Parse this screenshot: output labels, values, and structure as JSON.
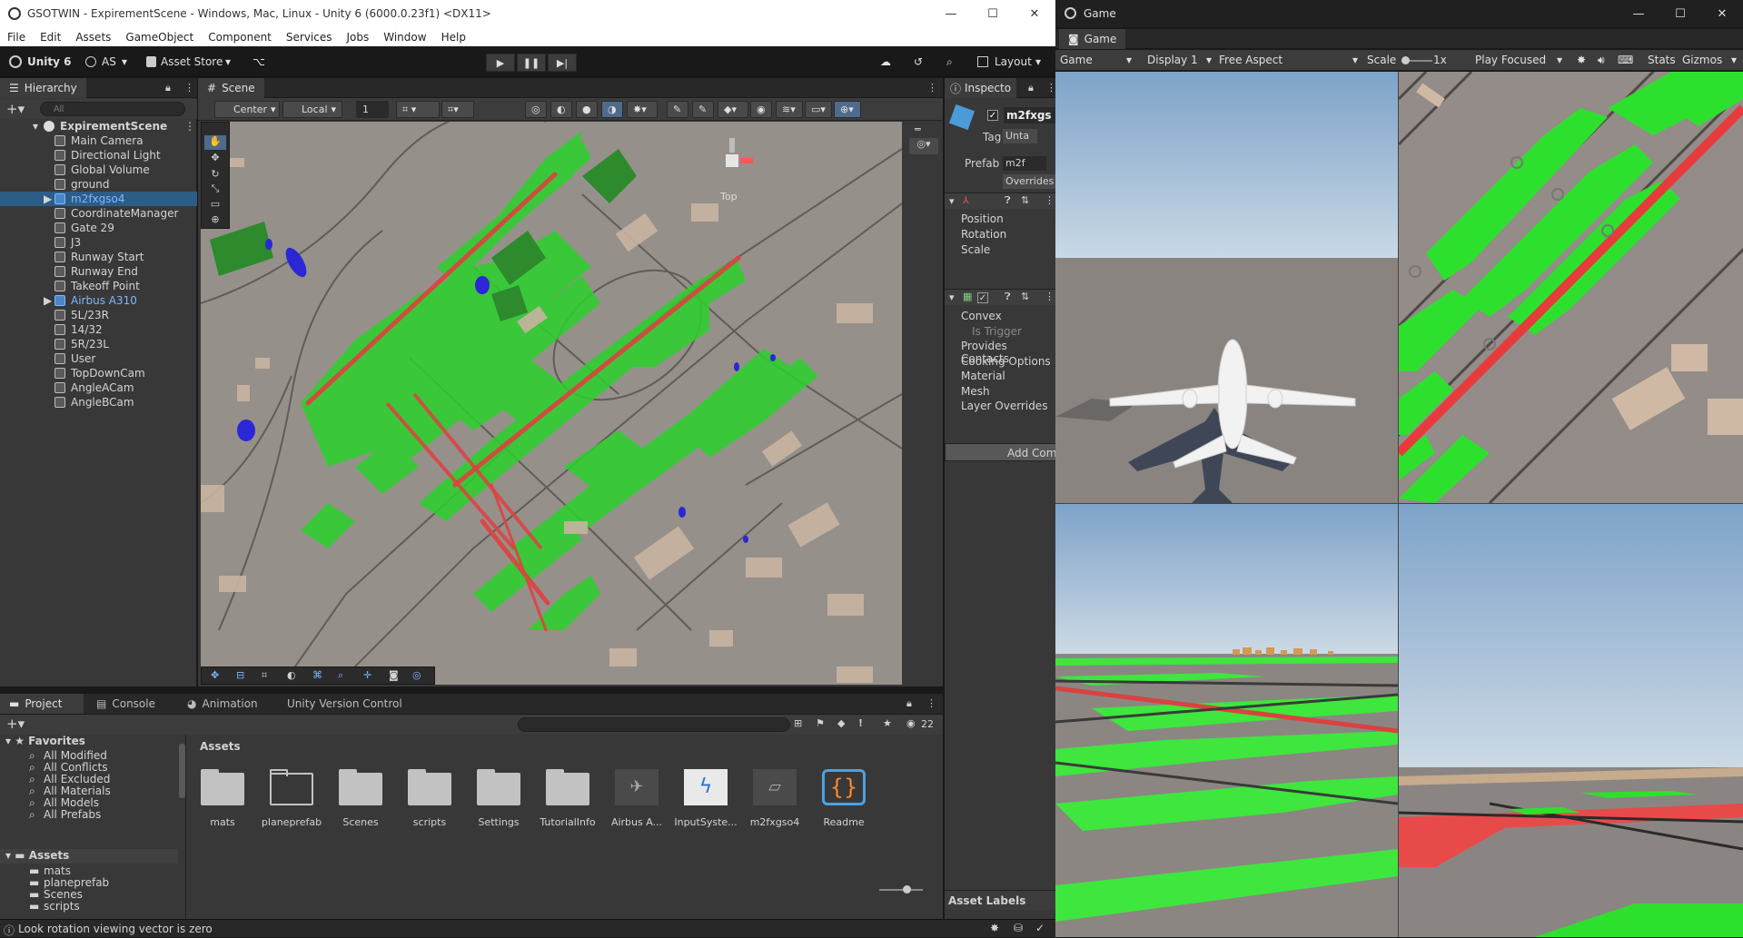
{
  "window": {
    "title": "GSOTWIN - ExpirementScene - Windows, Mac, Linux - Unity 6 (6000.0.23f1) <DX11>",
    "controls": {
      "minimize": "—",
      "maximize": "☐",
      "close": "✕"
    }
  },
  "menu": [
    "File",
    "Edit",
    "Assets",
    "GameObject",
    "Component",
    "Services",
    "Jobs",
    "Window",
    "Help"
  ],
  "toolbar": {
    "unity_label": "Unity 6",
    "account_label": "AS",
    "asset_store_label": "Asset Store",
    "layout_label": "Layout"
  },
  "hierarchy": {
    "tab_label": "Hierarchy",
    "search_placeholder": "All",
    "scene_name": "ExpirementScene",
    "items": [
      "Main Camera",
      "Directional Light",
      "Global Volume",
      "ground",
      "m2fxgso4",
      "CoordinateManager",
      "Gate 29",
      "J3",
      "Runway Start",
      "Runway End",
      "Takeoff Point",
      "Airbus A310",
      "5L/23R",
      "14/32",
      "5R/23L",
      "User",
      "TopDownCam",
      "AngleACam",
      "AngleBCam"
    ]
  },
  "scene": {
    "tab_label": "Scene",
    "pivot_label": "Center",
    "space_label": "Local",
    "snap_value": "1",
    "gizmo_label": "Top"
  },
  "inspector": {
    "tab_label": "Inspecto",
    "object_name": "m2fxgs",
    "tag_label": "Tag",
    "tag_value": "Unta",
    "prefab_label": "Prefab",
    "prefab_value": "m2f",
    "overrides_label": "Overrides",
    "transform_rows": [
      "Position",
      "Rotation",
      "Scale"
    ],
    "collider_rows": [
      "Convex",
      "Is Trigger",
      "Provides Contacts",
      "Cooking Options",
      "Material",
      "Mesh",
      "Layer Overrides"
    ],
    "add_component_label": "Add Comp",
    "asset_labels": "Asset Labels"
  },
  "project": {
    "tabs": [
      "Project",
      "Console",
      "Animation",
      "Unity Version Control"
    ],
    "favorites_label": "Favorites",
    "favorites": [
      "All Modified",
      "All Conflicts",
      "All Excluded",
      "All Materials",
      "All Models",
      "All Prefabs"
    ],
    "assets_label": "Assets",
    "tree": [
      "mats",
      "planeprefab",
      "Scenes",
      "scripts"
    ],
    "breadcrumb": "Assets",
    "count": "22",
    "items": [
      "mats",
      "planeprefab",
      "Scenes",
      "scripts",
      "Settings",
      "TutorialInfo",
      "Airbus A...",
      "InputSyste...",
      "m2fxgso4",
      "Readme"
    ]
  },
  "status": {
    "message": "Look rotation viewing vector is zero"
  },
  "game": {
    "window_title": "Game",
    "tab_label": "Game",
    "display_mode": "Game",
    "display": "Display 1",
    "aspect": "Free Aspect",
    "scale_label": "Scale",
    "scale_value": "1x",
    "play_mode": "Play Focused",
    "stats_label": "Stats",
    "gizmos_label": "Gizmos"
  }
}
